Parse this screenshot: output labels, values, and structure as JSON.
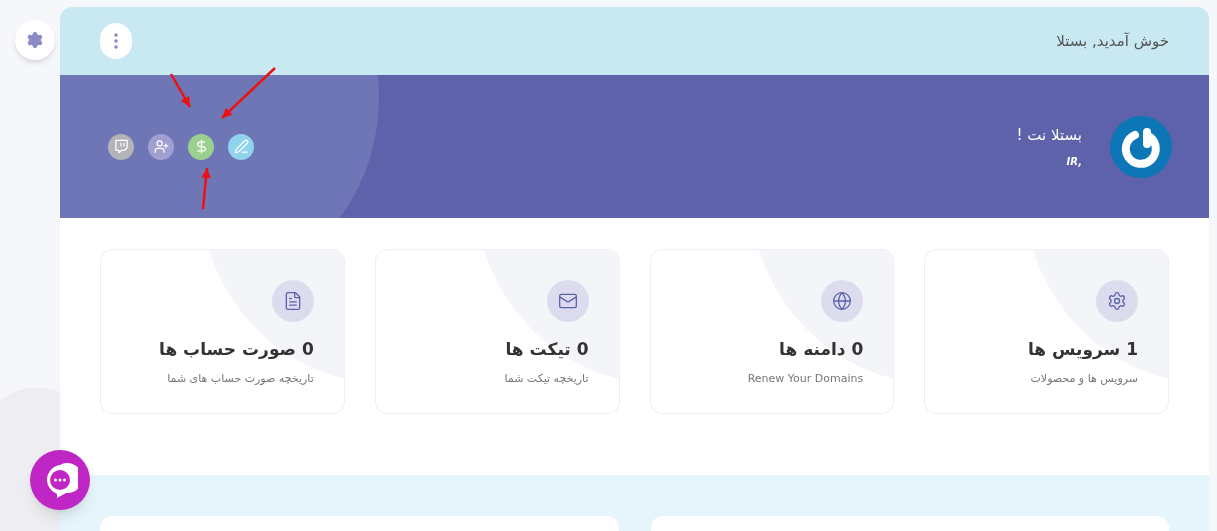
{
  "header": {
    "title": "خوش آمدید, بستلا"
  },
  "profile": {
    "name": "بستلا نت !",
    "subtitle": "IR,"
  },
  "cards": [
    {
      "kind": "gear",
      "title": "1 سرویس ها",
      "subtitle": "سرویس ها و محصولات"
    },
    {
      "kind": "globe",
      "title": "0 دامنه ها",
      "subtitle": "Renew Your Domains"
    },
    {
      "kind": "mail",
      "title": "0 تیکت ها",
      "subtitle": "تاریخچه تیکت شما"
    },
    {
      "kind": "file",
      "title": "0 صورت حساب ها",
      "subtitle": "تاریخچه صورت حساب های شما"
    }
  ]
}
